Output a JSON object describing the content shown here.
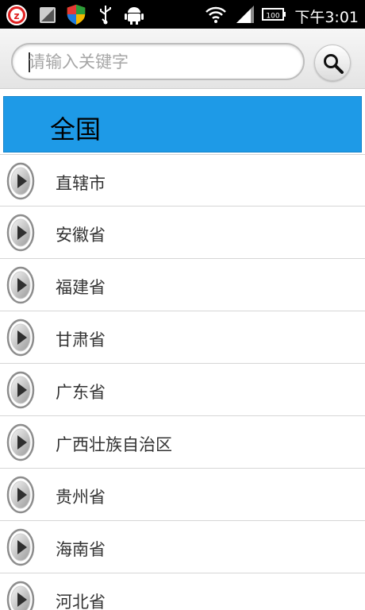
{
  "status_bar": {
    "time": "下午3:01",
    "icons": [
      "alarm-icon",
      "signal-app-icon",
      "shield-icon",
      "usb-icon",
      "android-debug-icon",
      "wifi-icon",
      "cell-signal-icon",
      "battery-icon"
    ],
    "battery_text": "100"
  },
  "search": {
    "placeholder": "请输入关键字",
    "value": ""
  },
  "header": {
    "title": "全国",
    "color": "#1e9ae7"
  },
  "regions": [
    {
      "label": "直辖市"
    },
    {
      "label": "安徽省"
    },
    {
      "label": "福建省"
    },
    {
      "label": "甘肃省"
    },
    {
      "label": "广东省"
    },
    {
      "label": "广西壮族自治区"
    },
    {
      "label": "贵州省"
    },
    {
      "label": "海南省"
    },
    {
      "label": "河北省"
    }
  ]
}
